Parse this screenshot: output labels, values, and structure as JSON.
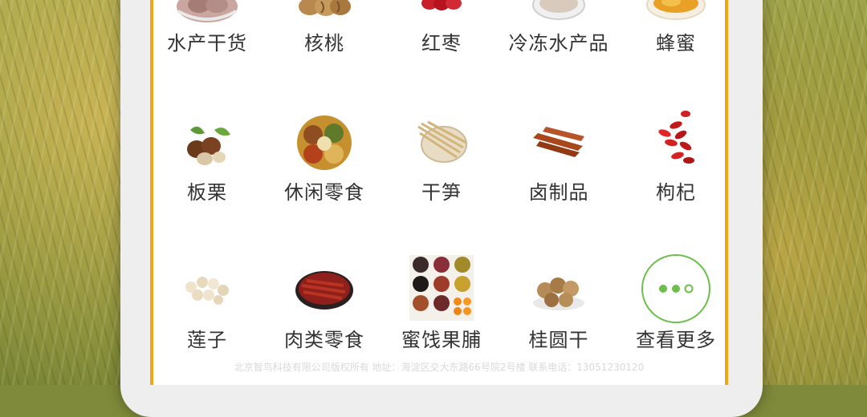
{
  "categories": [
    {
      "label": "水产干货",
      "icon": "dried-seafood-icon"
    },
    {
      "label": "核桃",
      "icon": "walnut-icon"
    },
    {
      "label": "红枣",
      "icon": "red-date-icon"
    },
    {
      "label": "冷冻水产品",
      "icon": "frozen-seafood-icon"
    },
    {
      "label": "蜂蜜",
      "icon": "honey-icon"
    },
    {
      "label": "板栗",
      "icon": "chestnut-icon"
    },
    {
      "label": "休闲零食",
      "icon": "snack-icon"
    },
    {
      "label": "干笋",
      "icon": "dried-bamboo-shoot-icon"
    },
    {
      "label": "卤制品",
      "icon": "braised-food-icon"
    },
    {
      "label": "枸杞",
      "icon": "goji-icon"
    },
    {
      "label": "莲子",
      "icon": "lotus-seed-icon"
    },
    {
      "label": "肉类零食",
      "icon": "jerky-icon"
    },
    {
      "label": "蜜饯果脯",
      "icon": "candied-fruit-icon"
    },
    {
      "label": "桂圆干",
      "icon": "longan-icon"
    },
    {
      "label": "查看更多",
      "icon": "more-icon"
    }
  ],
  "footer": "北京智鸟科技有限公司版权所有 地址：海淀区交大东路66号院2号楼 联系电话：13051230120",
  "colors": {
    "frame": "#f1a616",
    "more_circle": "#6cbf4a"
  }
}
